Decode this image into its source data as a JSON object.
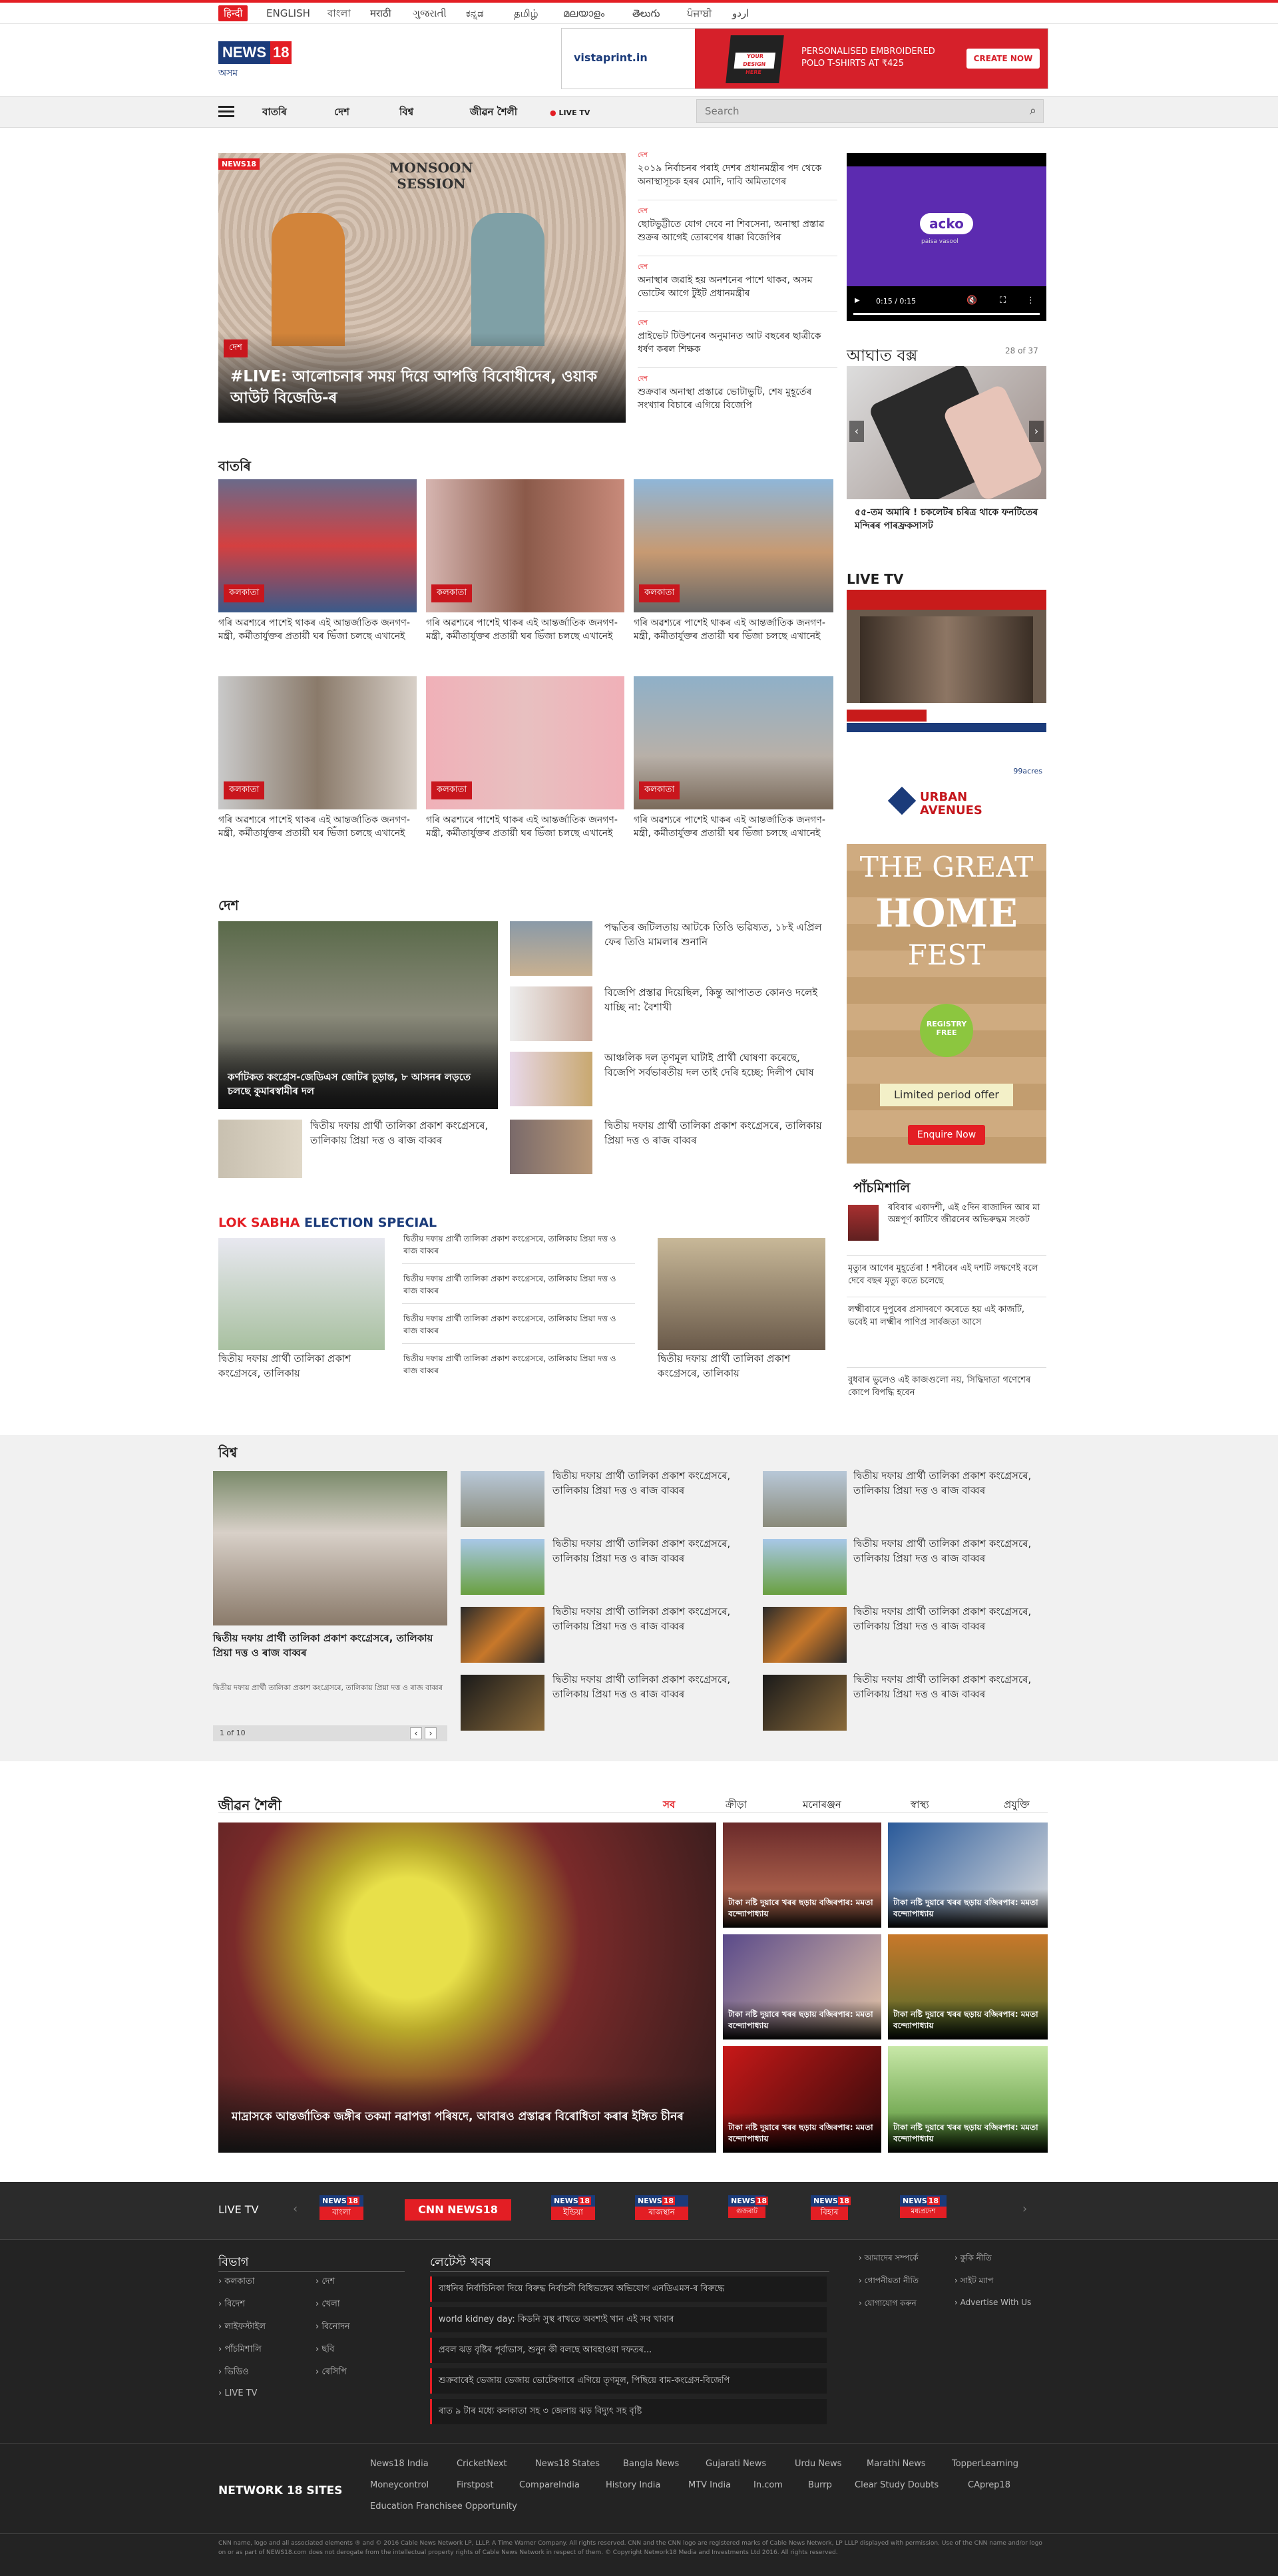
{
  "top_langs": [
    "हिन्दी",
    "ENGLISH",
    "বাংলা",
    "मराठी",
    "ગુજરાતી",
    "ಕನ್ನಡ",
    "தமிழ்",
    "മലയാളം",
    "తెలుగు",
    "ਪੰਜਾਬੀ",
    "اردو"
  ],
  "logo": {
    "brand": "NEWS",
    "num": "18",
    "sub": "অসম"
  },
  "top_ad": {
    "brand": "vistaprint.in",
    "text": "PERSONALISED EMBROIDERED POLO T-SHIRTS AT ₹425",
    "cta": "CREATE NOW",
    "badge": "YOUR DESIGN HERE"
  },
  "nav": {
    "items": [
      "বাতৰি",
      "দেশ",
      "বিশ্ব",
      "জীৱন শৈলী"
    ],
    "live": "LIVE TV",
    "search_placeholder": "Search"
  },
  "hero": {
    "tag": "দেশ",
    "headline": "#LIVE: আলোচনাৰ সময় দিয়ে আপত্তি বিবোধীদেৰ, ওয়াক আউট বিজেডি-ৰ",
    "img_text": "MONSOON SESSION"
  },
  "hero_list": [
    {
      "tag": "দেশ",
      "text": "২০১৯ নিৰ্বাচনৰ পৰাই দেশৰ প্ৰধানমন্ত্ৰীৰ পদ থেকে অনাস্থাসূচক হৰৰ মোদি, দাবি অমিতাগেৰ"
    },
    {
      "tag": "দেশ",
      "text": "ছোটভুট্টীতে যোগ দেবে না শিবসেনা, অনাস্থা প্ৰস্তাৱ শুক্ৰৰ আগেই তোৰণেৰ ধাক্কা বিজেপিৰ"
    },
    {
      "tag": "দেশ",
      "text": "অনাস্থাৰ জৱাই হয় অনশনেৰ পাশে থাকব, অসম ভোটেৰ আগে টুইট প্ৰধানমন্ত্ৰীৰ"
    },
    {
      "tag": "দেশ",
      "text": "প্ৰাইভেট টিউশনেৰ অনুমানত আট বছৰেৰ ছাত্ৰীকে ধৰ্ষণ কৰল শিক্ষক"
    },
    {
      "tag": "দেশ",
      "text": "শুক্ৰবাৰ অনাস্থা প্ৰস্তাৱে ভোটাভুটি, শেষ মুহূৰ্তেৰ সংখ্যাৰ বিচাৰে এগিয়ে বিজেপি"
    }
  ],
  "video": {
    "brand": "acko",
    "tagline": "paisa vasool",
    "time": "0:15 / 0:15"
  },
  "gallery": {
    "title": "আঘাত বক্স",
    "count": "28 of 37",
    "caption": "৫৫-তম অমাৰি ! চকলেটৰ চৰিত্ৰ থাকে ফনটিতেৰ মন্দিৰৰ পাৰফ্ৰকসাসট"
  },
  "live_tv": {
    "title": "LIVE TV"
  },
  "sidead": {
    "brand": "URBAN AVENUES",
    "line1": "THE GREAT",
    "line2": "HOME",
    "line3": "FEST",
    "pill": "Limited period offer",
    "cta": "Enquire Now",
    "badge": "REGISTRY FREE",
    "corner": "99acres"
  },
  "news": {
    "title": "বাতৰি",
    "items": [
      {
        "tag": "কলকাতা",
        "text": "গৰি অৱশ্যৰে পাশেই থাকৰ এই আন্তর্জাতিক জনগণ-মন্ত্ৰী, কৰ্মীতাৰ্যুক্তৰ প্ৰতাৰ্য়ী ঘৰ ভিঁজা চলছে এখানেই"
      },
      {
        "tag": "কলকাতা",
        "text": "গৰি অৱশ্যৰে পাশেই থাকৰ এই আন্তর্জাতিক জনগণ-মন্ত্ৰী, কৰ্মীতাৰ্যুক্তৰ প্ৰতাৰ্য়ী ঘৰ ভিঁজা চলছে এখানেই"
      },
      {
        "tag": "কলকাতা",
        "text": "গৰি অৱশ্যৰে পাশেই থাকৰ এই আন্তর্জাতিক জনগণ-মন্ত্ৰী, কৰ্মীতাৰ্যুক্তৰ প্ৰতাৰ্য়ী ঘৰ ভিঁজা চলছে এখানেই"
      },
      {
        "tag": "কলকাতা",
        "text": "গৰি অৱশ্যৰে পাশেই থাকৰ এই আন্তর্জাতিক জনগণ-মন্ত্ৰী, কৰ্মীতাৰ্যুক্তৰ প্ৰতাৰ্য়ী ঘৰ ভিঁজা চলছে এখানেই"
      },
      {
        "tag": "কলকাতা",
        "text": "গৰি অৱশ্যৰে পাশেই থাকৰ এই আন্তর্জাতিক জনগণ-মন্ত্ৰী, কৰ্মীতাৰ্যুক্তৰ প্ৰতাৰ্য়ী ঘৰ ভিঁজা চলছে এখানেই"
      },
      {
        "tag": "কলকাতা",
        "text": "গৰি অৱশ্যৰে পাশেই থাকৰ এই আন্তর্জাতিক জনগণ-মন্ত্ৰী, কৰ্মীতাৰ্যুক্তৰ প্ৰতাৰ্য়ী ঘৰ ভিঁজা চলছে এখানেই"
      }
    ]
  },
  "desh": {
    "title": "দেশ",
    "main": "কৰ্ণাটকত কংগ্ৰেস-জেডিএস জোটৰ চূড়ান্ত, ৮ আসনৰ লড়তে চলছে কুমাৰস্বামীৰ দল",
    "sub": "দ্বিতীয় দফায় প্ৰাৰ্থী তালিকা প্ৰকাশ কংগ্ৰেসৰে, তালিকায় প্ৰিয়া দত্ত ও ৰাজ বাব্বৰ",
    "list": [
      "পদ্ধতিৰ জটিলতায় আটকে তিওি ভৱিষ্যত, ১৮ই এপ্ৰিল ফেৰ তিওি মামলাৰ শুনানি",
      "বিজেপি প্ৰস্তাৱ দিয়েছিল, কিন্তু আপাতত কোনও দলেই যাচ্ছি না: বৈশাখী",
      "আঞ্চলিক দল তৃণমূল ঘাটাই প্ৰাৰ্থী ঘোষণা কৰেছে, বিজেপি সৰ্বভাৰতীয় দল তাই দেৰি হচ্ছে: দিলীপ ঘোষ",
      "দ্বিতীয় দফায় প্ৰাৰ্থী তালিকা প্ৰকাশ কংগ্ৰেসৰে, তালিকায় প্ৰিয়া দত্ত ও ৰাজ বাব্বৰ"
    ]
  },
  "panch": {
    "title": "পাঁচমিশালি",
    "items": [
      "ৰবিবাৰ একাদশী, এই ৫দিন ৰাজাদিন আৰ মা অন্নপূৰ্ণ কাটিবে জীৱনেৰ অভিৰুদ্ধম সংকট",
      "মৃত্যুৰ আগেৰ মুহূৰ্তেৰা ! শৰীৰেৰ এই দশটি লক্ষণেই বলে দেবে বছৰ মৃত্যু কতে চলেছে",
      "লক্ষ্মীবাৰে দুপুৰেৰ প্ৰসাদৰণে কৰেতে হয় এই কাজটি, ভবেই মা লক্ষ্মীৰ পাণিপ্ৰ সাৰ্বজতা আসে",
      "বুধবাৰ ভুলেও এই কাজগুলো নয়, সিদ্ধিদাতা গণেশেৰ কোপে বিপদ্ধি হবেন"
    ]
  },
  "lok": {
    "title_red": "LOK SABHA",
    "title_blue": "ELECTION SPECIAL",
    "main1": "দ্বিতীয় দফায় প্ৰাৰ্থী তালিকা প্ৰকাশ কংগ্ৰেসৰে, তালিকায়",
    "main2": "দ্বিতীয় দফায় প্ৰাৰ্থী তালিকা প্ৰকাশ কংগ্ৰেসৰে, তালিকায়",
    "list": [
      "দ্বিতীয় দফায় প্ৰাৰ্থী তালিকা প্ৰকাশ কংগ্ৰেসৰে, তালিকায় প্ৰিয়া দত্ত ও ৰাজ বাব্বৰ",
      "দ্বিতীয় দফায় প্ৰাৰ্থী তালিকা প্ৰকাশ কংগ্ৰেসৰে, তালিকায় প্ৰিয়া দত্ত ও ৰাজ বাব্বৰ",
      "দ্বিতীয় দফায় প্ৰাৰ্থী তালিকা প্ৰকাশ কংগ্ৰেসৰে, তালিকায় প্ৰিয়া দত্ত ও ৰাজ বাব্বৰ",
      "দ্বিতীয় দফায় প্ৰাৰ্থী তালিকা প্ৰকাশ কংগ্ৰেসৰে, তালিকায় প্ৰিয়া দত্ত ও ৰাজ বাব্বৰ"
    ]
  },
  "world": {
    "title": "বিশ্ব",
    "main": "দ্বিতীয় দফায় প্ৰাৰ্থী তালিকা প্ৰকাশ কংগ্ৰেসৰে, তালিকায় প্ৰিয়া দত্ত ও ৰাজ বাব্বৰ",
    "sub": "দ্বিতীয় দফায় প্ৰাৰ্থী তালিকা প্ৰকাশ কংগ্ৰেসৰে, তালিকায় প্ৰিয়া দত্ত ও ৰাজ বাব্বৰ",
    "pager": "1 of 10",
    "item": "দ্বিতীয় দফায় প্ৰাৰ্থী তালিকা প্ৰকাশ কংগ্ৰেসৰে, তালিকায় প্ৰিয়া দত্ত ও ৰাজ বাব্বৰ"
  },
  "life": {
    "title": "জীৱন শৈলী",
    "tabs": [
      "সব",
      "ক্ৰীড়া",
      "মনোৰঞ্জন",
      "স্বাস্থ্য",
      "প্ৰযুক্তি"
    ],
    "main": "মাদ্ৰাসকে আন্তৰ্জাতিক জঙ্গীৰ তকমা নৱাপত্তা পৰিষদে, আবাৰও প্ৰস্তাৱৰ বিৰোধিতা কৰাৰ ইঙ্গিত চীনৰ",
    "item": "টাকা নষ্টি দুয়াৰে খৰৰ ছড়ায় বজিৰপাৰ: মমতা বন্দ্যোপাধ্যায়"
  },
  "livetv_strip": {
    "label": "LIVE TV",
    "channels": [
      "বাংলা",
      "CNN NEWS18",
      "ইন্ডিয়া",
      "ৰাজস্থান",
      "গুজৰাট",
      "বিহাৰ",
      "মধ্যপ্ৰদেশ"
    ]
  },
  "footer": {
    "cat_title": "বিভাগ",
    "cats_left": [
      "কলকাতা",
      "বিদেশ",
      "লাইফস্টাইল",
      "পাঁচমিশালি",
      "ভিডিও",
      "LIVE TV"
    ],
    "cats_right": [
      "দেশ",
      "খেলা",
      "বিনোদন",
      "ছবি",
      "ৰেসিপি"
    ],
    "latest_title": "লেটেস্ট খবৰ",
    "latest": [
      "বাধনিৰ নিৰ্বাচিনিকা দিয়ে বিৰুদ্ধ নিৰ্বাচনী বিধিভঙ্গেৰ অভিযোগ এনডিএমস-ৰ বিৰুদ্ধে",
      "world kidney day: কিডনি সুস্থ ৰাখতে অবশ্যই খান এই সব খাবাৰ",
      "প্ৰবল ঝড় বৃষ্টিৰ পূৰ্বাভাস, শুনুন কী বলছে আবহাওয়া দফতৰ...",
      "শুক্ৰবাৰেই ভেজায় ভেজায় ভোটেৰগাৰে এগিয়ে তৃণমূল, পিছিয়ে বাম-কংগ্ৰেস-বিজেপি",
      "ৰাত ৯ টাৰ মধ্যে কলকাতা সহ ৩ জেলায় ঝড় বিদ্যুৎ সহ বৃষ্টি"
    ],
    "links_left": [
      "আমাদেৰ সম্পৰ্কে",
      "গোপনীয়তা নীতি",
      "যোগাযোগ কৰুন"
    ],
    "links_right": [
      "কুকি নীতি",
      "সাইট ম্যাপ",
      "Advertise With Us"
    ],
    "network_title": "NETWORK 18 SITES",
    "network": [
      "News18 India",
      "CricketNext",
      "News18 States",
      "Bangla News",
      "Gujarati News",
      "Urdu News",
      "Marathi News",
      "TopperLearning",
      "Moneycontrol",
      "Firstpost",
      "CompareIndia",
      "History India",
      "MTV India",
      "In.com",
      "Burrp",
      "Clear Study Doubts",
      "CAprep18",
      "Education Franchisee Opportunity"
    ],
    "copyright": "CNN name, logo and all associated elements ® and © 2016 Cable News Network LP, LLLP. A Time Warner Company. All rights reserved. CNN and the CNN logo are registered marks of Cable News Network, LP LLLP displayed with permission. Use of the CNN name and/or logo on or as part of NEWS18.com does not derogate from the intellectual property rights of Cable News Network in respect of them. © Copyright Network18 Media and Investments Ltd 2016. All rights reserved."
  }
}
